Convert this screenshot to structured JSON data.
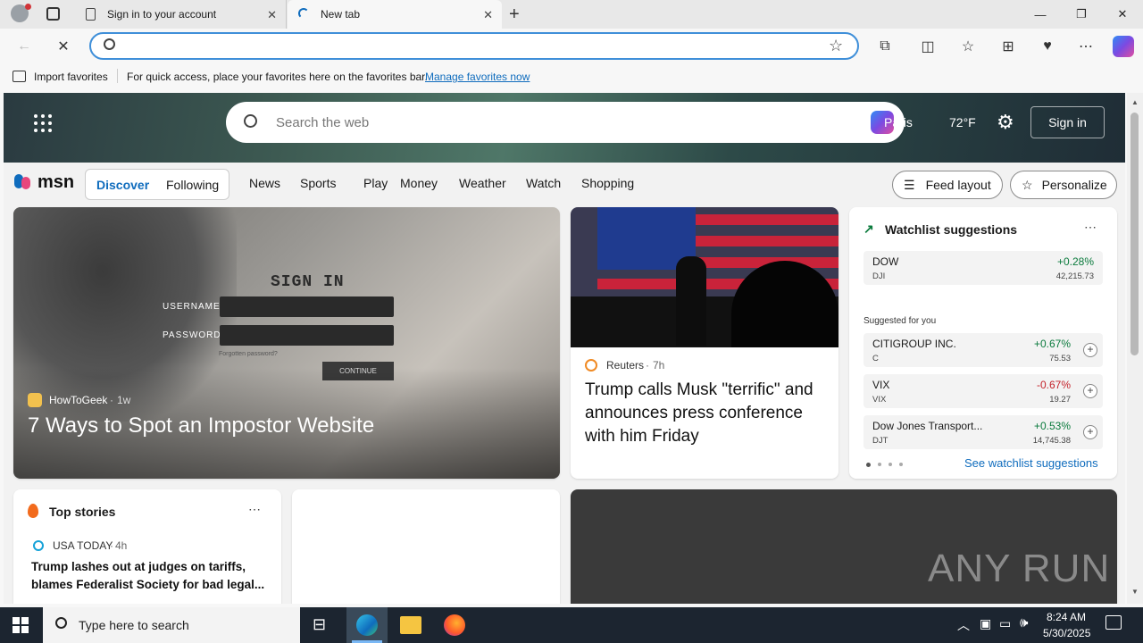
{
  "browser": {
    "tabs": [
      {
        "title": "Sign in to your account"
      },
      {
        "title": "New tab"
      }
    ],
    "favorites_bar": {
      "import_label": "Import favorites",
      "hint": "For quick access, place your favorites here on the favorites bar.",
      "manage_link": "Manage favorites now"
    }
  },
  "msn": {
    "search_placeholder": "Search the web",
    "location_text": "Paris",
    "temperature": "72°F",
    "sign_in": "Sign in",
    "logo_text": "msn",
    "feed_tabs": [
      "Discover",
      "Following"
    ],
    "nav_items": [
      "News",
      "Sports",
      "Play",
      "Money",
      "Weather",
      "Watch",
      "Shopping"
    ],
    "feed_layout": "Feed layout",
    "personalize": "Personalize",
    "hero_story": {
      "source": "HowToGeek",
      "age": "1w",
      "headline": "7 Ways to Spot an Impostor Website",
      "image_text": {
        "sign_in": "SIGN IN",
        "username": "USERNAME",
        "password": "PASSWORD",
        "forgot": "Forgotten password?",
        "continue": "CONTINUE"
      }
    },
    "news_card": {
      "source": "Reuters",
      "age": "7h",
      "headline": "Trump calls Musk \"terrific\" and announces press conference with him Friday"
    },
    "watchlist": {
      "title": "Watchlist suggestions",
      "main": {
        "name": "DOW",
        "symbol": "DJI",
        "change": "+0.28%",
        "price": "42,215.73"
      },
      "suggested_label": "Suggested for you",
      "suggested": [
        {
          "name": "CITIGROUP INC.",
          "symbol": "C",
          "change": "+0.67%",
          "price": "75.53",
          "color": "#0a7a3c"
        },
        {
          "name": "VIX",
          "symbol": "VIX",
          "change": "-0.67%",
          "price": "19.27",
          "color": "#c4232b"
        },
        {
          "name": "Dow Jones Transport...",
          "symbol": "DJT",
          "change": "+0.53%",
          "price": "14,745.38",
          "color": "#0a7a3c"
        }
      ],
      "see_more": "See watchlist suggestions"
    },
    "top_stories": {
      "title": "Top stories",
      "source": "USA TODAY",
      "age": "4h",
      "headline": "Trump lashes out at judges on tariffs, blames Federalist Society for bad legal..."
    },
    "watermark": "ANY RUN"
  },
  "taskbar": {
    "search_placeholder": "Type here to search",
    "time": "8:24 AM",
    "date": "5/30/2025"
  },
  "colors": {
    "accent": "#0f6cbd",
    "positive": "#0a7a3c",
    "negative": "#c4232b"
  }
}
